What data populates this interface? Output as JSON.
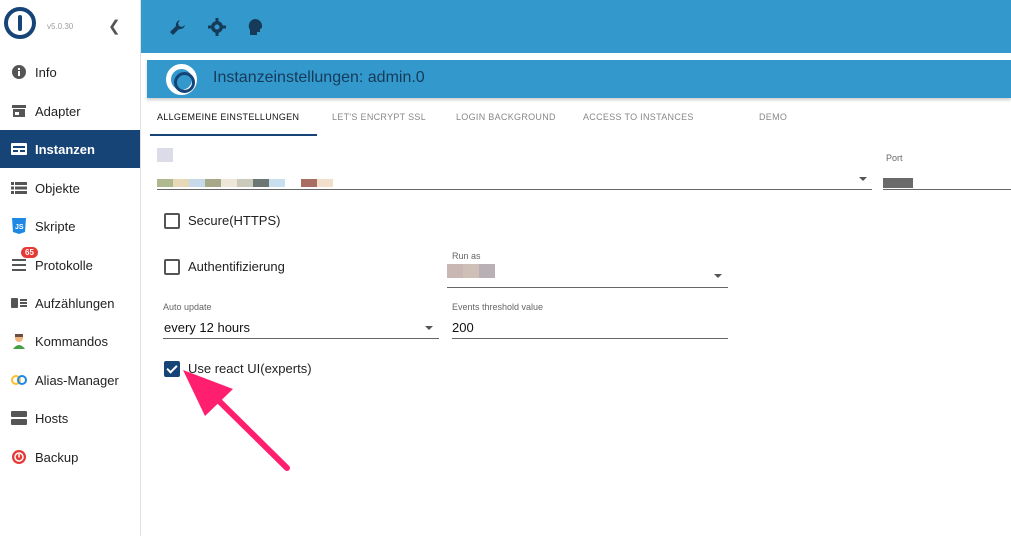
{
  "sidebar": {
    "version": "v5.0.30",
    "items": [
      {
        "label": "Info",
        "icon": "info-icon"
      },
      {
        "label": "Adapter",
        "icon": "store-icon"
      },
      {
        "label": "Instanzen",
        "icon": "instances-icon"
      },
      {
        "label": "Objekte",
        "icon": "list-icon"
      },
      {
        "label": "Skripte",
        "icon": "javascript-icon"
      },
      {
        "label": "Protokolle",
        "icon": "log-icon",
        "badge": "65"
      },
      {
        "label": "Aufzählungen",
        "icon": "enum-icon"
      },
      {
        "label": "Kommandos",
        "icon": "user-icon"
      },
      {
        "label": "Alias-Manager",
        "icon": "alias-icon"
      },
      {
        "label": "Hosts",
        "icon": "hosts-icon"
      },
      {
        "label": "Backup",
        "icon": "backup-icon"
      }
    ]
  },
  "toolbar": {
    "icons": [
      "wrench-icon",
      "gear-icon",
      "head-icon"
    ]
  },
  "instance": {
    "title": "Instanzeinstellungen: admin.0"
  },
  "tabs": [
    "ALLGEMEINE EINSTELLUNGEN",
    "LET'S ENCRYPT SSL",
    "LOGIN BACKGROUND",
    "ACCESS TO INSTANCES",
    "DEMO"
  ],
  "form": {
    "port_label": "Port",
    "secure_label": "Secure(HTTPS)",
    "auth_label": "Authentifizierung",
    "run_as_label": "Run as",
    "auto_update_label": "Auto update",
    "auto_update_value": "every 12 hours",
    "events_threshold_label": "Events threshold value",
    "events_threshold_value": "200",
    "react_ui_label": "Use react UI(experts)",
    "secure_checked": false,
    "auth_checked": false,
    "react_ui_checked": true
  },
  "colors": {
    "accent": "#3399cc",
    "active": "#164477",
    "arrow": "#ff1f6e"
  }
}
